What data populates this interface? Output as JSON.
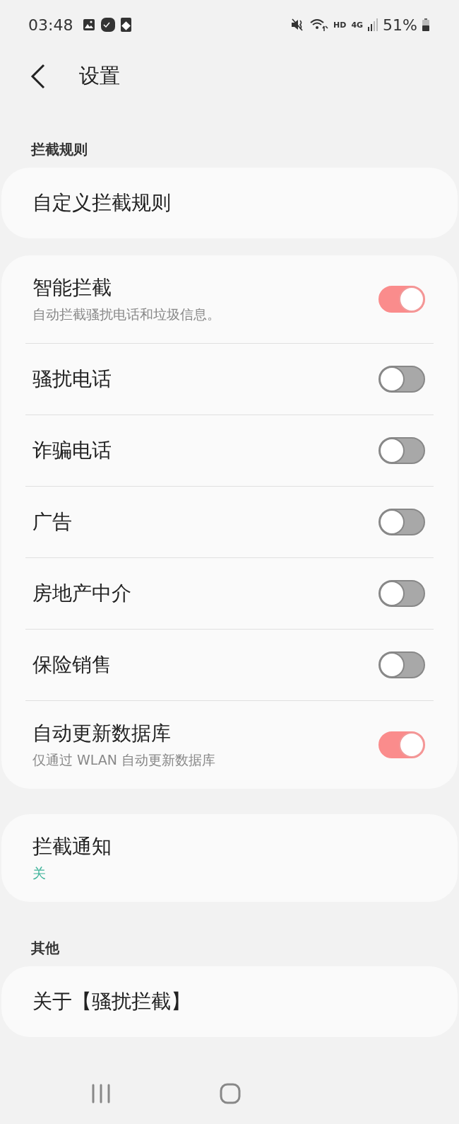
{
  "status_bar": {
    "time": "03:48",
    "network_labels": [
      "HD",
      "4G"
    ],
    "battery_percent": "51%"
  },
  "header": {
    "title": "设置"
  },
  "groups": [
    {
      "label": "拦截规则",
      "rows": [
        {
          "kind": "link",
          "title": "自定义拦截规则"
        }
      ]
    },
    {
      "rows": [
        {
          "kind": "toggle",
          "title": "智能拦截",
          "subtitle": "自动拦截骚扰电话和垃圾信息。",
          "on": true
        },
        {
          "kind": "toggle",
          "title": "骚扰电话",
          "on": false
        },
        {
          "kind": "toggle",
          "title": "诈骗电话",
          "on": false
        },
        {
          "kind": "toggle",
          "title": "广告",
          "on": false
        },
        {
          "kind": "toggle",
          "title": "房地产中介",
          "on": false
        },
        {
          "kind": "toggle",
          "title": "保险销售",
          "on": false
        },
        {
          "kind": "toggle",
          "title": "自动更新数据库",
          "subtitle": "仅通过 WLAN 自动更新数据库",
          "on": true
        }
      ]
    },
    {
      "rows": [
        {
          "kind": "value",
          "title": "拦截通知",
          "value": "关"
        }
      ]
    },
    {
      "label": "其他",
      "rows": [
        {
          "kind": "link",
          "title": "关于【骚扰拦截】"
        }
      ]
    }
  ]
}
